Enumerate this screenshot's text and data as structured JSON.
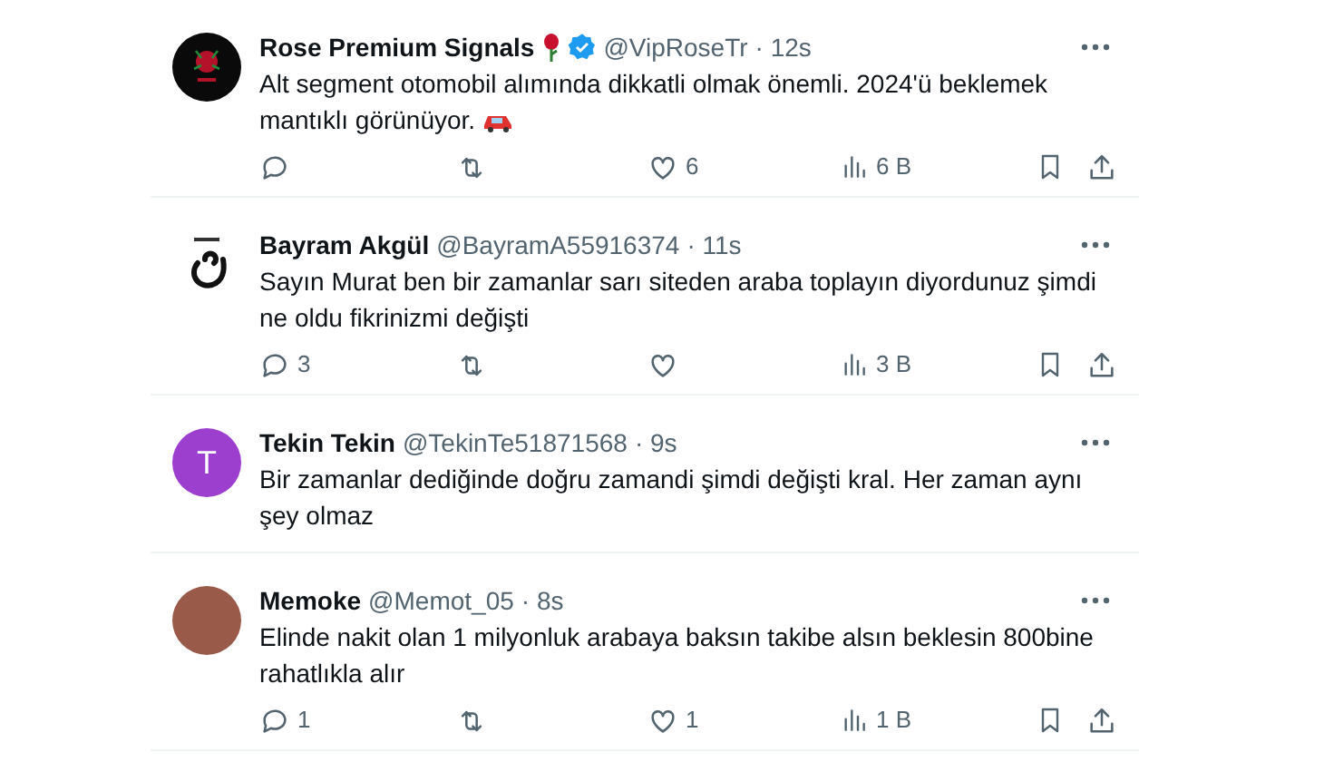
{
  "tweets": [
    {
      "avatar": {
        "kind": "rose-logo"
      },
      "name": "Rose Premium Signals",
      "name_badges": [
        {
          "kind": "rose"
        },
        {
          "kind": "verified"
        }
      ],
      "handle": "@VipRoseTr",
      "time": "· 12s",
      "text": "Alt segment otomobil alımında dikkatli olmak önemli. 2024'ü beklemek mantıklı görünüyor.",
      "text_emoji": [
        {
          "kind": "car"
        }
      ],
      "actions": {
        "likes": "6",
        "views": "6 B"
      }
    },
    {
      "avatar": {
        "kind": "letter-logo"
      },
      "name": "Bayram Akgül",
      "handle": "@BayramA55916374",
      "time": "· 11s",
      "text": "Sayın Murat ben bir zamanlar sarı siteden araba toplayın diyordunuz şimdi ne oldu fikrinizmi değişti",
      "actions": {
        "replies": "3",
        "views": "3 B"
      }
    },
    {
      "avatar": {
        "kind": "initial",
        "initial": "T",
        "color": "#9c3fcf"
      },
      "name": "Tekin Tekin",
      "handle": "@TekinTe51871568",
      "time": "· 9s",
      "text": "Bir zamanlar dediğinde doğru zamandi şimdi değişti kral. Her zaman aynı şey olmaz"
    },
    {
      "avatar": {
        "kind": "photo"
      },
      "name": "Memoke",
      "handle": "@Memot_05",
      "time": "· 8s",
      "text": "Elinde nakit olan 1 milyonluk arabaya baksın takibe alsın beklesin 800bine rahatlıkla alır",
      "actions": {
        "replies": "1",
        "likes": "1",
        "views": "1 B"
      }
    }
  ]
}
